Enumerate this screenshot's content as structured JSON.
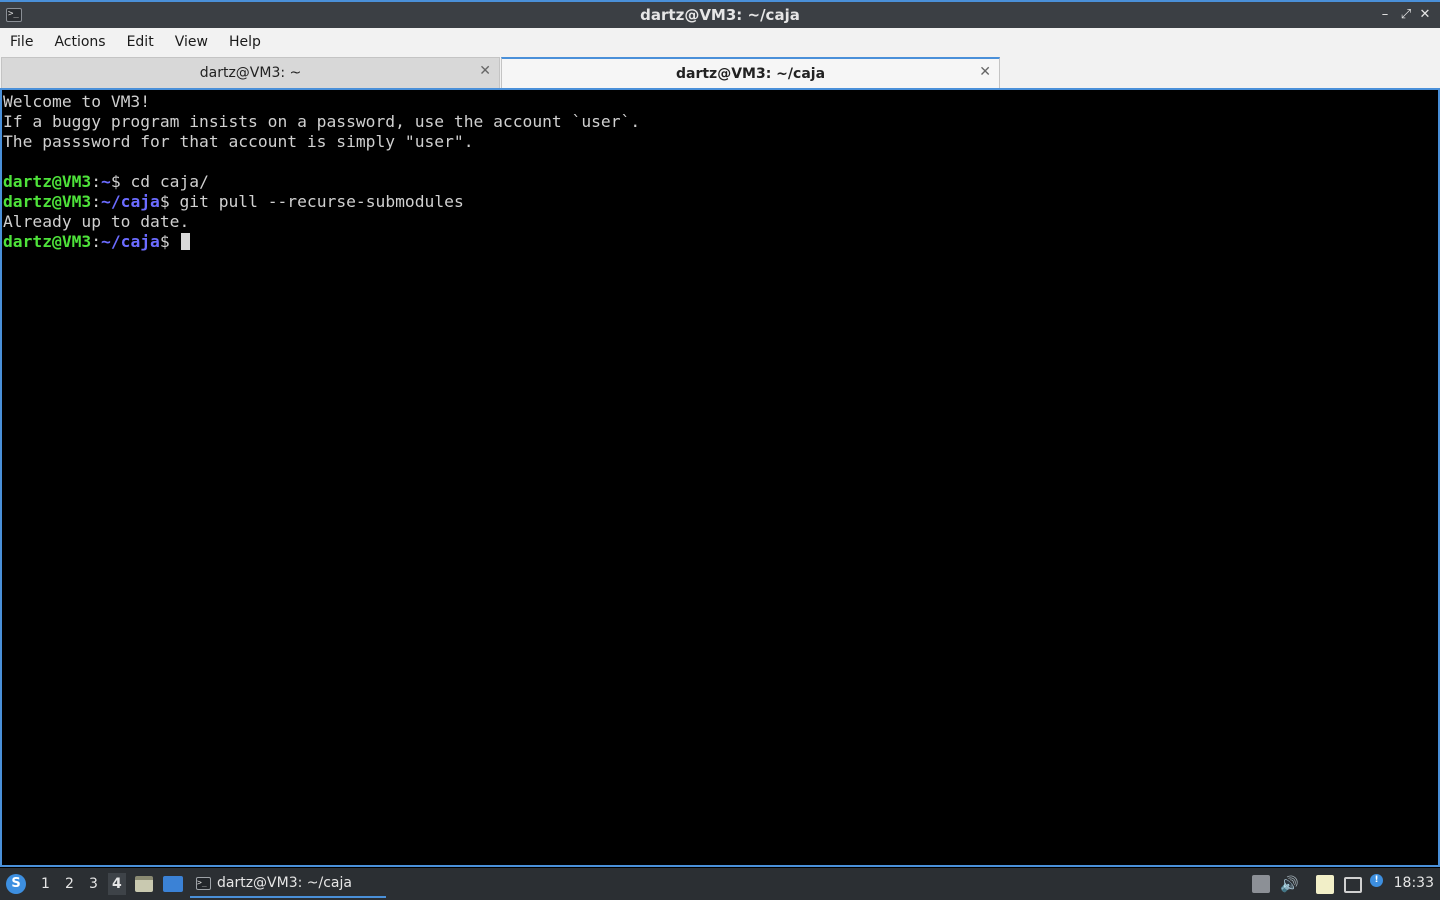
{
  "window": {
    "title": "dartz@VM3: ~/caja",
    "app_icon_glyph": ">_",
    "minimize_glyph": "–",
    "restore_glyph": "⤢",
    "close_glyph": "✕"
  },
  "menu": {
    "items": [
      "File",
      "Actions",
      "Edit",
      "View",
      "Help"
    ]
  },
  "tabs": [
    {
      "label": "dartz@VM3: ~",
      "active": false
    },
    {
      "label": "dartz@VM3: ~/caja",
      "active": true
    }
  ],
  "tab_close_glyph": "✕",
  "terminal": {
    "motd": [
      "Welcome to VM3!",
      "If a buggy program insists on a password, use the account `user`.",
      "The passsword for that account is simply \"user\"."
    ],
    "commands": [
      {
        "user": "dartz@VM3",
        "sep": ":",
        "path": "~",
        "prompt": "$ ",
        "command": "cd caja/"
      },
      {
        "user": "dartz@VM3",
        "sep": ":",
        "path": "~/caja",
        "prompt": "$ ",
        "command": "git pull --recurse-submodules"
      }
    ],
    "output": "Already up to date.",
    "current_prompt": {
      "user": "dartz@VM3",
      "sep": ":",
      "path": "~/caja",
      "prompt": "$ "
    }
  },
  "taskbar": {
    "start_glyph": "S",
    "desktops": [
      "1",
      "2",
      "3",
      "4"
    ],
    "current_desktop": "4",
    "task_label": "dartz@VM3: ~/caja",
    "task_icon_glyph": ">_",
    "volume_glyph": "🔊",
    "update_glyph": "!",
    "clock": "18:33"
  },
  "colors": {
    "accent": "#4a90d9",
    "prompt_user": "#4ee23a",
    "prompt_path": "#6b6bff",
    "terminal_bg": "#000000",
    "terminal_fg": "#d0d0d0"
  }
}
